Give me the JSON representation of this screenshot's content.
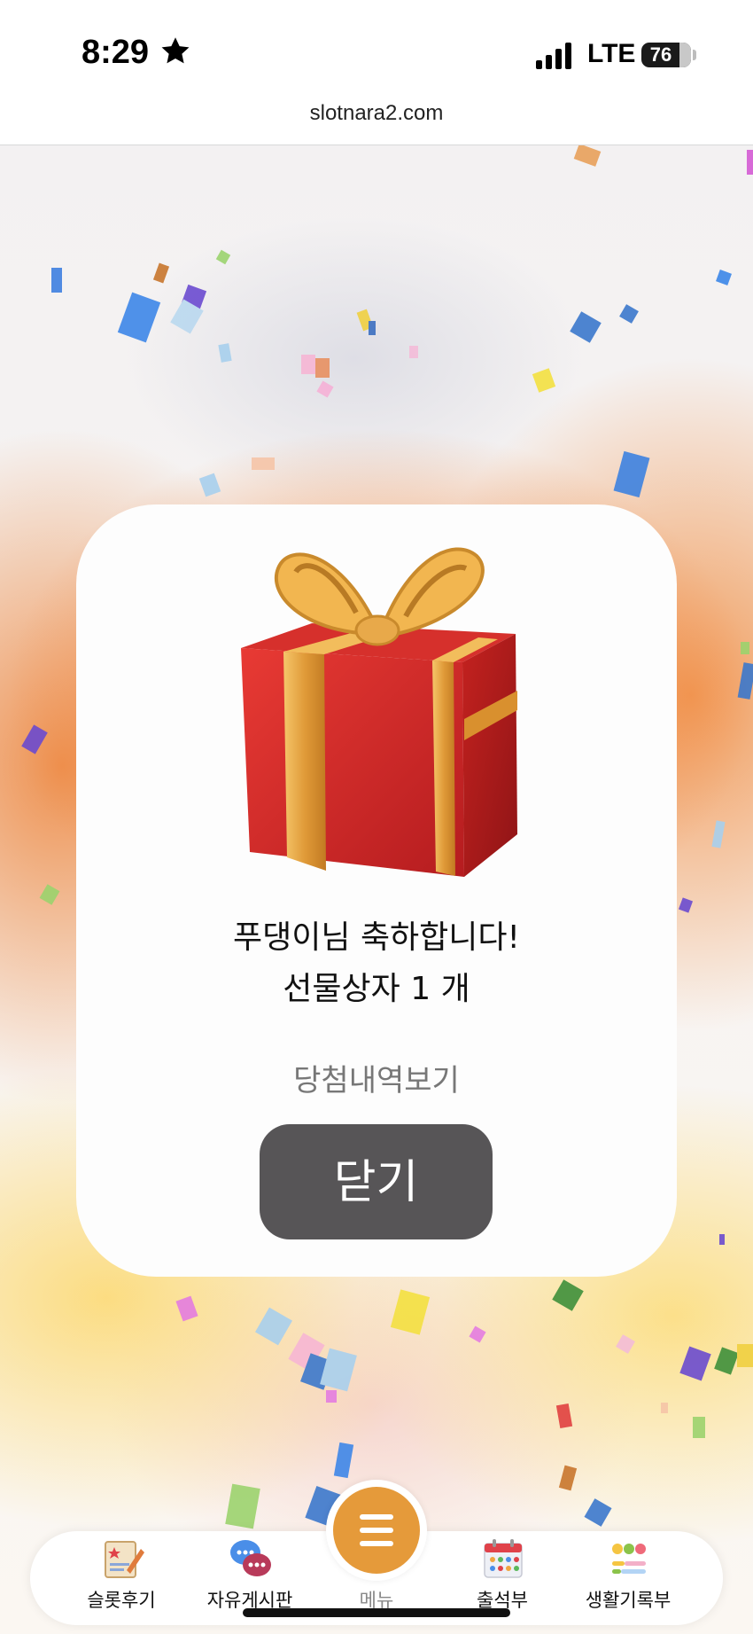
{
  "status_bar": {
    "time": "8:29",
    "network": "LTE",
    "battery": "76",
    "battery_level": 0.76
  },
  "browser": {
    "url": "slotnara2.com"
  },
  "popup": {
    "congrats_line1": "푸댕이님 축하합니다!",
    "congrats_line2": "선물상자 1 개",
    "history_link": "당첨내역보기",
    "close_label": "닫기"
  },
  "bottom_nav": {
    "items": [
      {
        "label": "슬롯후기",
        "icon": "review-icon"
      },
      {
        "label": "자유게시판",
        "icon": "chat-bubbles-icon"
      },
      {
        "label": "메뉴",
        "icon": "hamburger-menu-icon"
      },
      {
        "label": "출석부",
        "icon": "calendar-icon"
      },
      {
        "label": "생활기록부",
        "icon": "emoji-chart-icon"
      }
    ]
  },
  "colors": {
    "accent_orange": "#e59a3a",
    "close_button": "#575557",
    "gift_red": "#d62a2a",
    "ribbon_gold": "#e8a94a"
  }
}
